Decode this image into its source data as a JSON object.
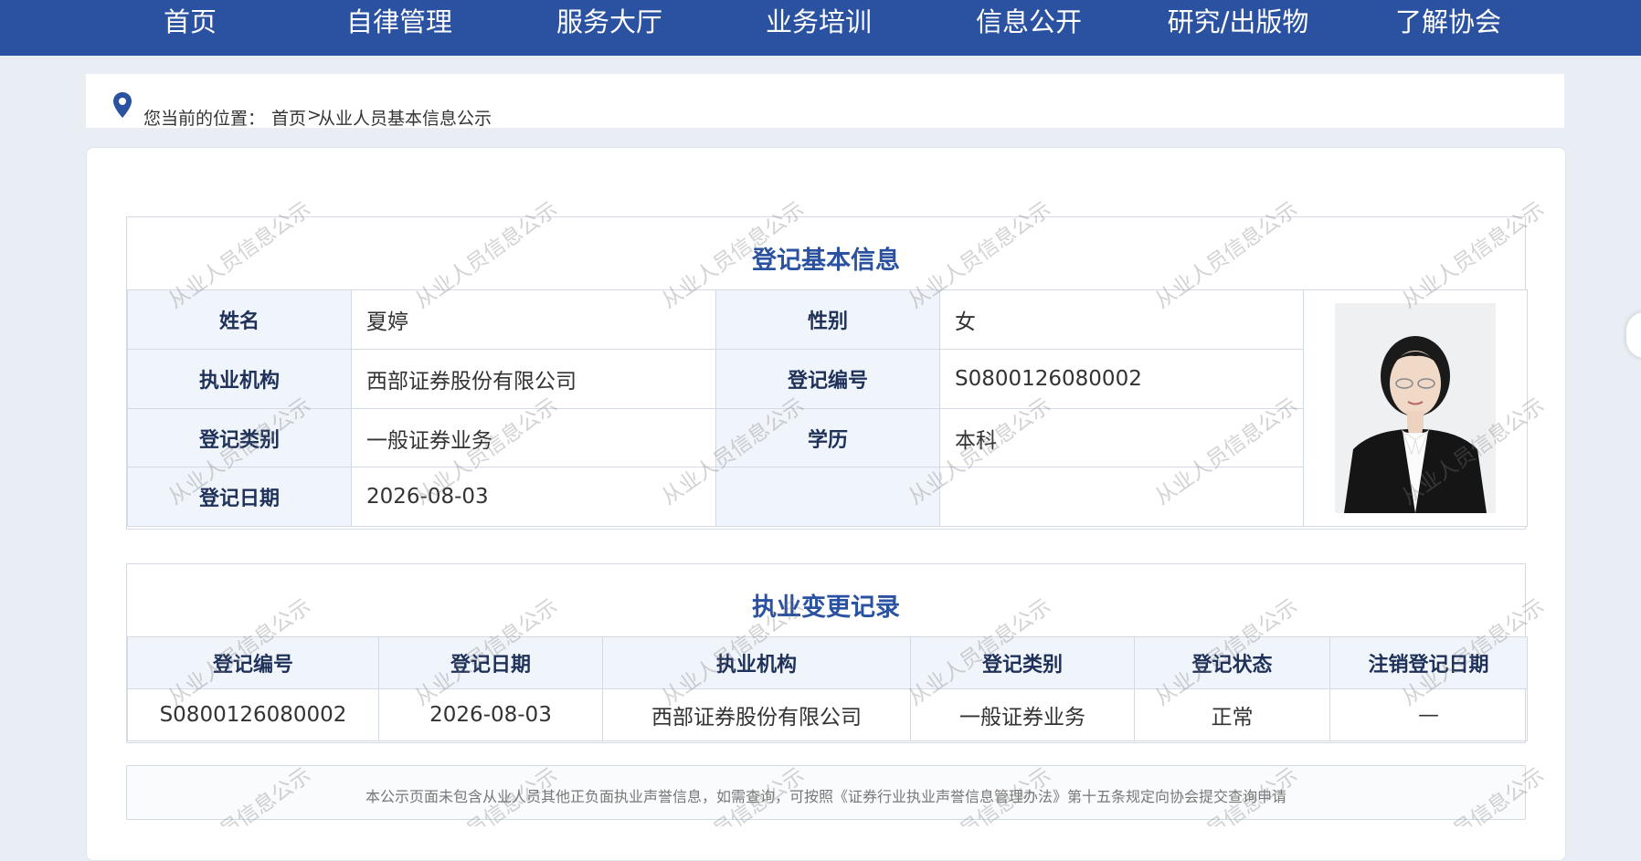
{
  "nav": {
    "items": [
      "首页",
      "自律管理",
      "服务大厅",
      "业务培训",
      "信息公开",
      "研究/出版物",
      "了解协会"
    ]
  },
  "breadcrumb": {
    "label": "您当前的位置：",
    "home": "首页",
    "separator": ">",
    "current": "从业人员基本信息公示"
  },
  "basic_info": {
    "title": "登记基本信息",
    "name_label": "姓名",
    "name": "夏婷",
    "gender_label": "性别",
    "gender": "女",
    "org_label": "执业机构",
    "org": "西部证券股份有限公司",
    "reg_no_label": "登记编号",
    "reg_no": "S0800126080002",
    "reg_type_label": "登记类别",
    "reg_type": "一般证券业务",
    "edu_label": "学历",
    "edu": "本科",
    "reg_date_label": "登记日期",
    "reg_date": "2026-08-03"
  },
  "change_records": {
    "title": "执业变更记录",
    "headers": [
      "登记编号",
      "登记日期",
      "执业机构",
      "登记类别",
      "登记状态",
      "注销登记日期"
    ],
    "rows": [
      [
        "S0800126080002",
        "2026-08-03",
        "西部证券股份有限公司",
        "一般证券业务",
        "正常",
        "—"
      ]
    ]
  },
  "notice": "本公示页面未包含从业人员其他正负面执业声誉信息，如需查询，可按照《证券行业执业声誉信息管理办法》第十五条规定向协会提交查询申请",
  "watermark": "从业人员信息公示",
  "colors": {
    "nav_bg": "#2b52a1",
    "title": "#2b52a1",
    "label_bg": "#f0f5fc",
    "page_bg": "#e9eef4"
  }
}
